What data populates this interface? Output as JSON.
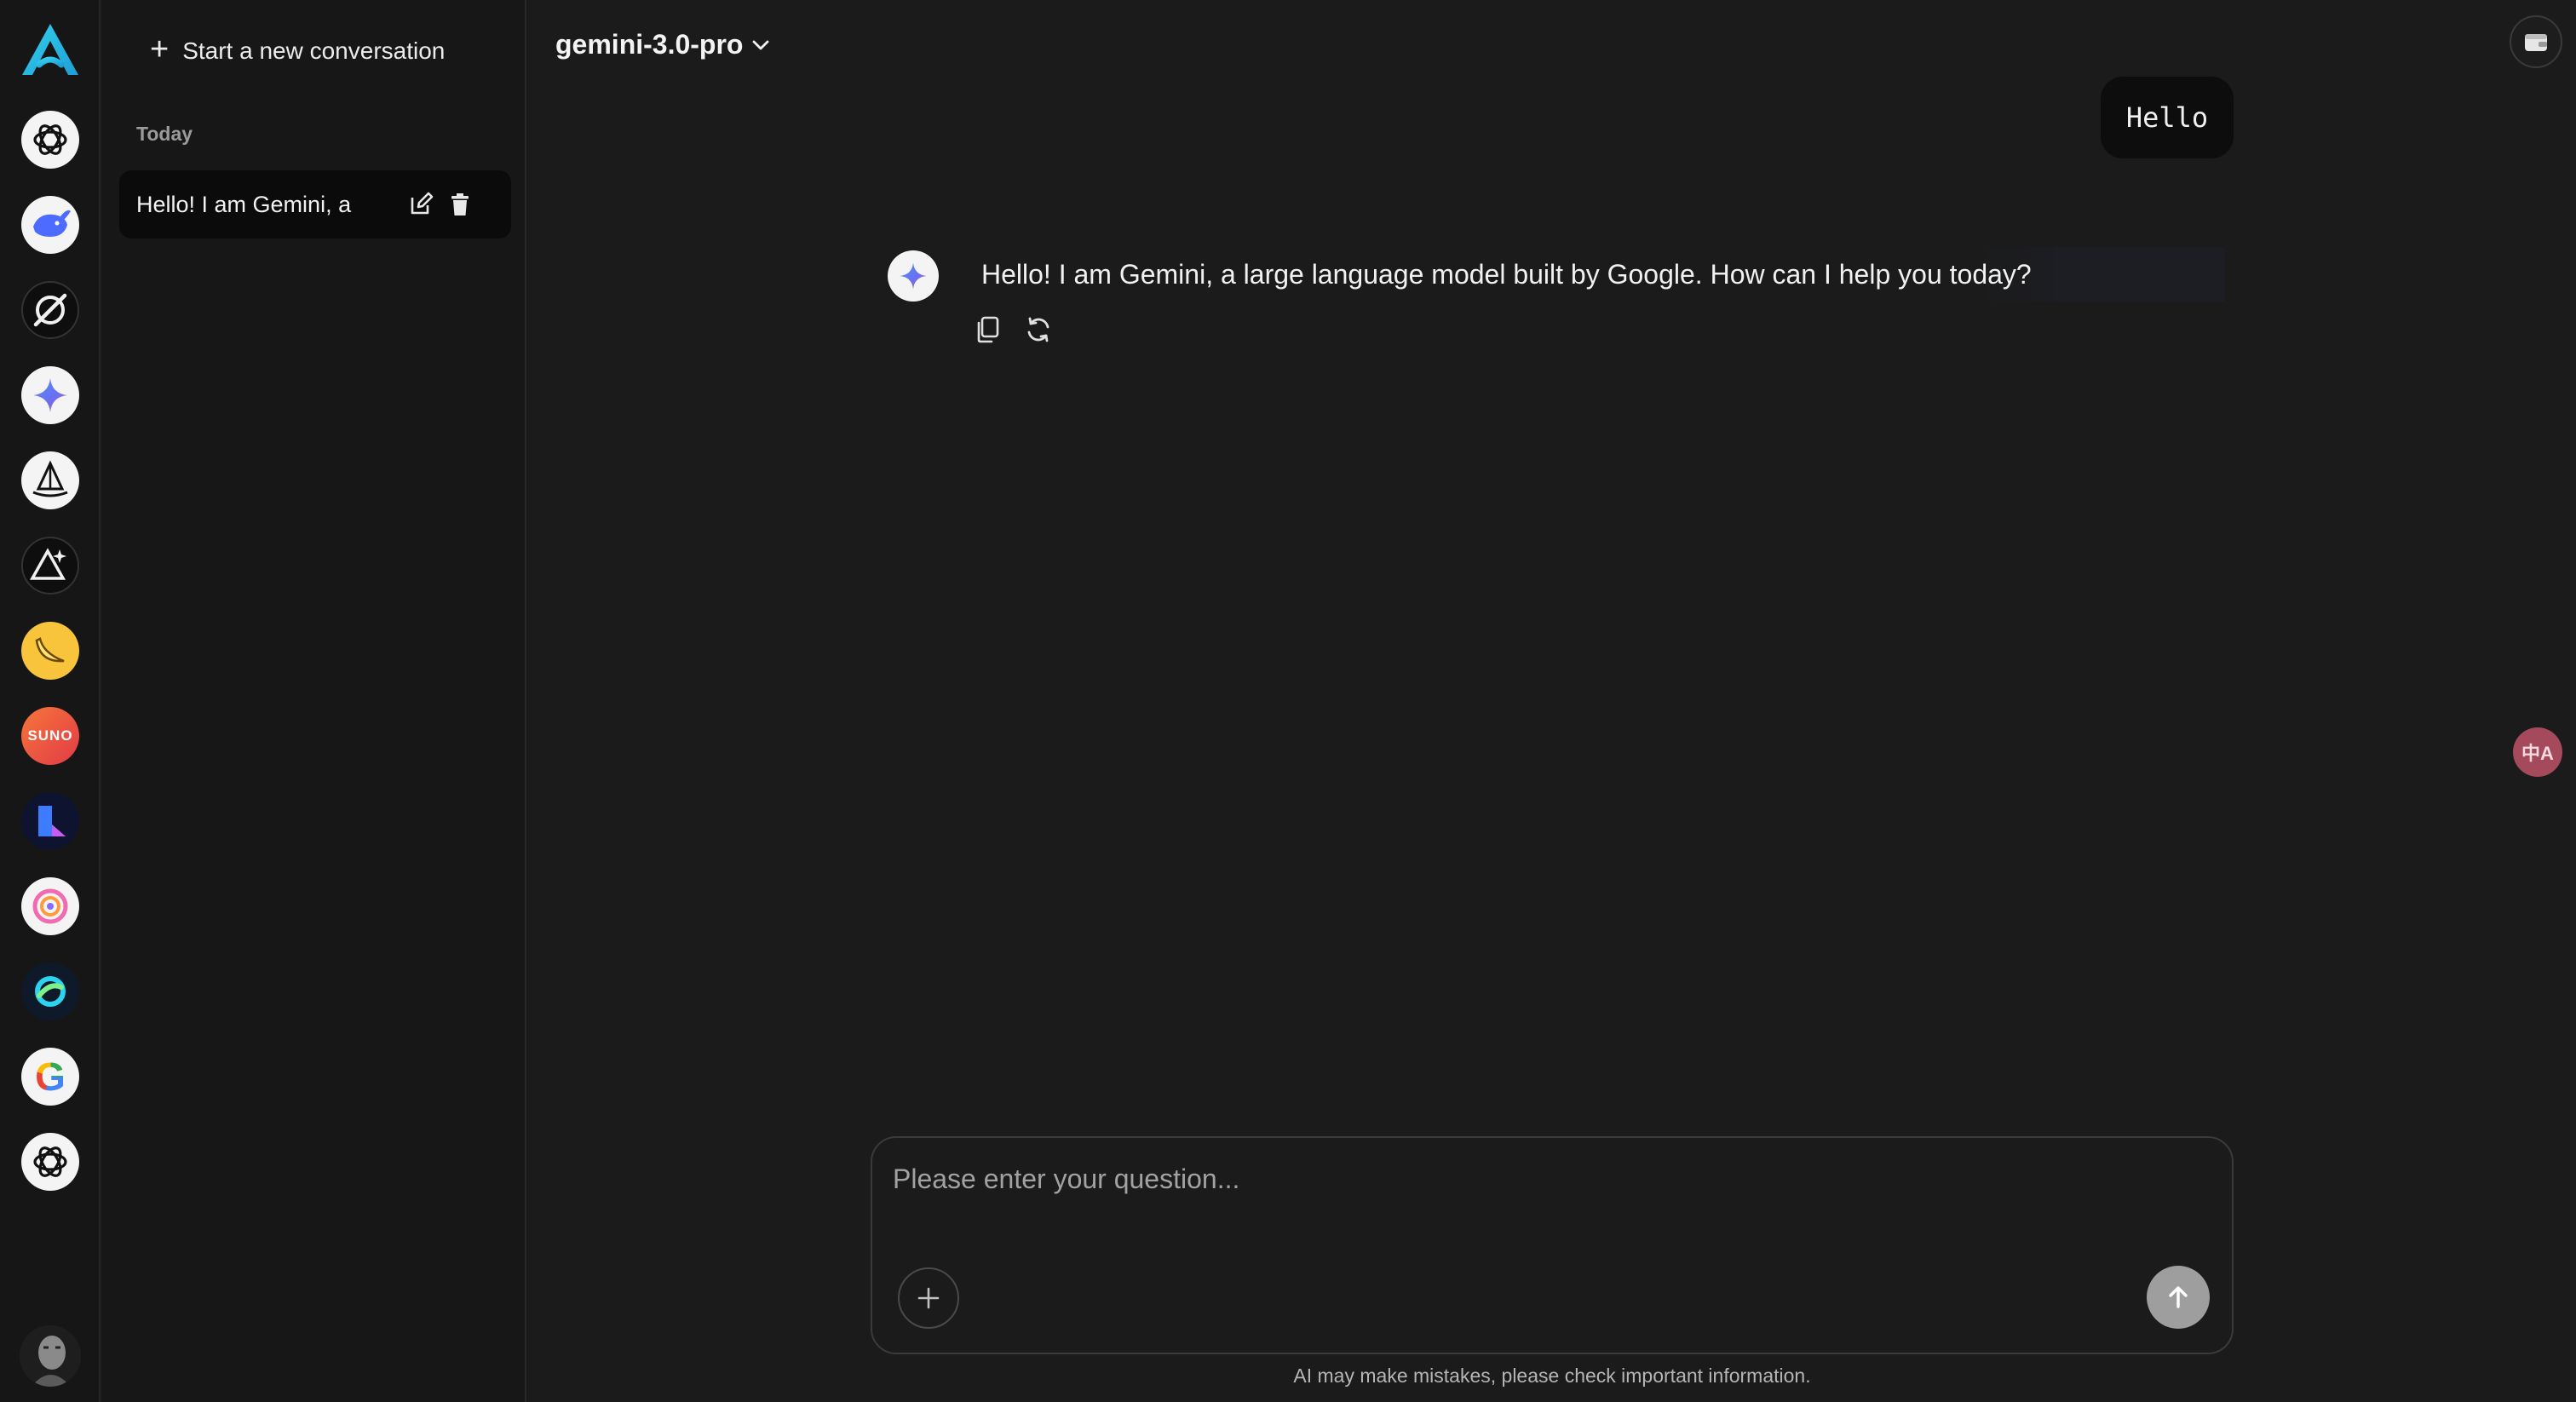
{
  "rail": {
    "items": [
      {
        "name": "chatgpt",
        "icon": "openai-icon"
      },
      {
        "name": "deepseek",
        "icon": "whale-icon"
      },
      {
        "name": "grok",
        "icon": "grok-icon"
      },
      {
        "name": "gemini",
        "icon": "sparkle-icon"
      },
      {
        "name": "midjourney",
        "icon": "sailboat-icon"
      },
      {
        "name": "triangle-app",
        "icon": "triangle-sparkle-icon"
      },
      {
        "name": "banana",
        "icon": "banana-icon"
      },
      {
        "name": "suno",
        "icon": "suno-icon",
        "label": "SUNO"
      },
      {
        "name": "kling",
        "icon": "kling-icon"
      },
      {
        "name": "swirl-app",
        "icon": "swirl-icon"
      },
      {
        "name": "ring-app",
        "icon": "ring-icon"
      },
      {
        "name": "google",
        "icon": "google-icon",
        "label": "G"
      },
      {
        "name": "openai-2",
        "icon": "openai-icon"
      }
    ]
  },
  "sidebar": {
    "new_conversation": "Start a new conversation",
    "group_label": "Today",
    "conversations": [
      {
        "title": "Hello! I am Gemini, a"
      }
    ]
  },
  "header": {
    "model": "gemini-3.0-pro"
  },
  "messages": {
    "user": "Hello",
    "assistant": "Hello! I am Gemini, a large language model built by Google. How can I help you today?"
  },
  "composer": {
    "placeholder": "Please enter your question..."
  },
  "footer": {
    "disclaimer": "AI may make mistakes, please check important information."
  },
  "translate_fab": "中A",
  "colors": {
    "background": "#1b1b1b",
    "sidebar": "#171717",
    "accent_cyan": "#2ec4e6",
    "suno": "#f2572d",
    "banana": "#f7c43b",
    "translate": "#a44a5c"
  }
}
